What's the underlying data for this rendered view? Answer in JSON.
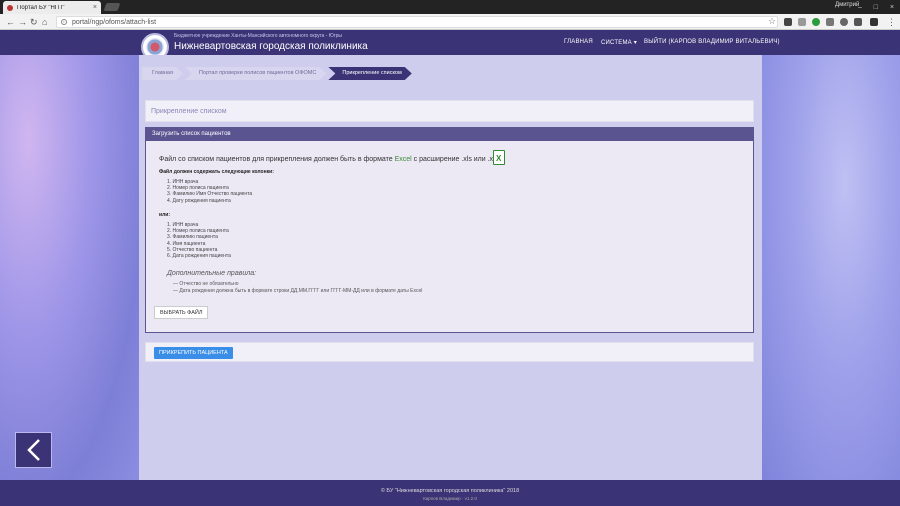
{
  "browser": {
    "tab_title": "Портал БУ \"НГП\"",
    "tab_close": "×",
    "user": "Дмитрий",
    "url": "portal/ngp/ofoms/attach-list",
    "nav": {
      "back": "←",
      "forward": "→",
      "reload": "↻",
      "home": "⌂"
    },
    "star": "☆",
    "win": {
      "min": "–",
      "max": "□",
      "close": "×"
    }
  },
  "header": {
    "org_small": "Бюджетное учреждение Ханты-Мансийского автономного округа - Югры",
    "org_big": "Нижневартовская городская поликлиника",
    "menu": [
      "ГЛАВНАЯ",
      "СИСТЕМА ▾",
      "ВЫЙТИ (КАРПОВ ВЛАДИМИР ВИТАЛЬЕВИЧ)"
    ]
  },
  "breadcrumb": [
    "Главная",
    "Портал проверки полисов пациентов ОФОМС",
    "Прикрепление списком"
  ],
  "page_title": "Прикрепление списком",
  "panel": {
    "heading": "Загрузить список пациентов",
    "main_pre": "Файл со списком пациентов для прикрепления должен быть в формате ",
    "main_excel": "Excel",
    "main_post": " с расширение .xls или .xlsx",
    "xls_icon": "X",
    "sub1": "Файл должен содержать следующие колонки:",
    "list1": [
      "1. ИНН врача",
      "2. Номер полиса пациента",
      "3. Фамилию Имя Отчество пациента",
      "4. Дату рождения пациента"
    ],
    "or": "или:",
    "list2": [
      "1. ИНН врача",
      "2. Номер полиса пациента",
      "3. Фамилию пациента",
      "4. Имя пациента",
      "5. Отчество пациента",
      "6. Дата рождения пациента"
    ],
    "extra_title": "Дополнительные правила:",
    "rules": [
      "— Отчество не обязательно",
      "— Дата рождения должна быть в формате строки ДД.ММ.ГГГГ или ГГГГ-ММ-ДД или в формате даты Excel"
    ],
    "choose_file": "ВЫБРАТЬ ФАЙЛ"
  },
  "attach_button": "ПРИКРЕПИТЬ ПАЦИЕНТА",
  "footer": {
    "line1": "© БУ \"Нижневартовская городская поликлиника\" 2018",
    "line2": "Карпов Владимир · v1.2.0"
  }
}
